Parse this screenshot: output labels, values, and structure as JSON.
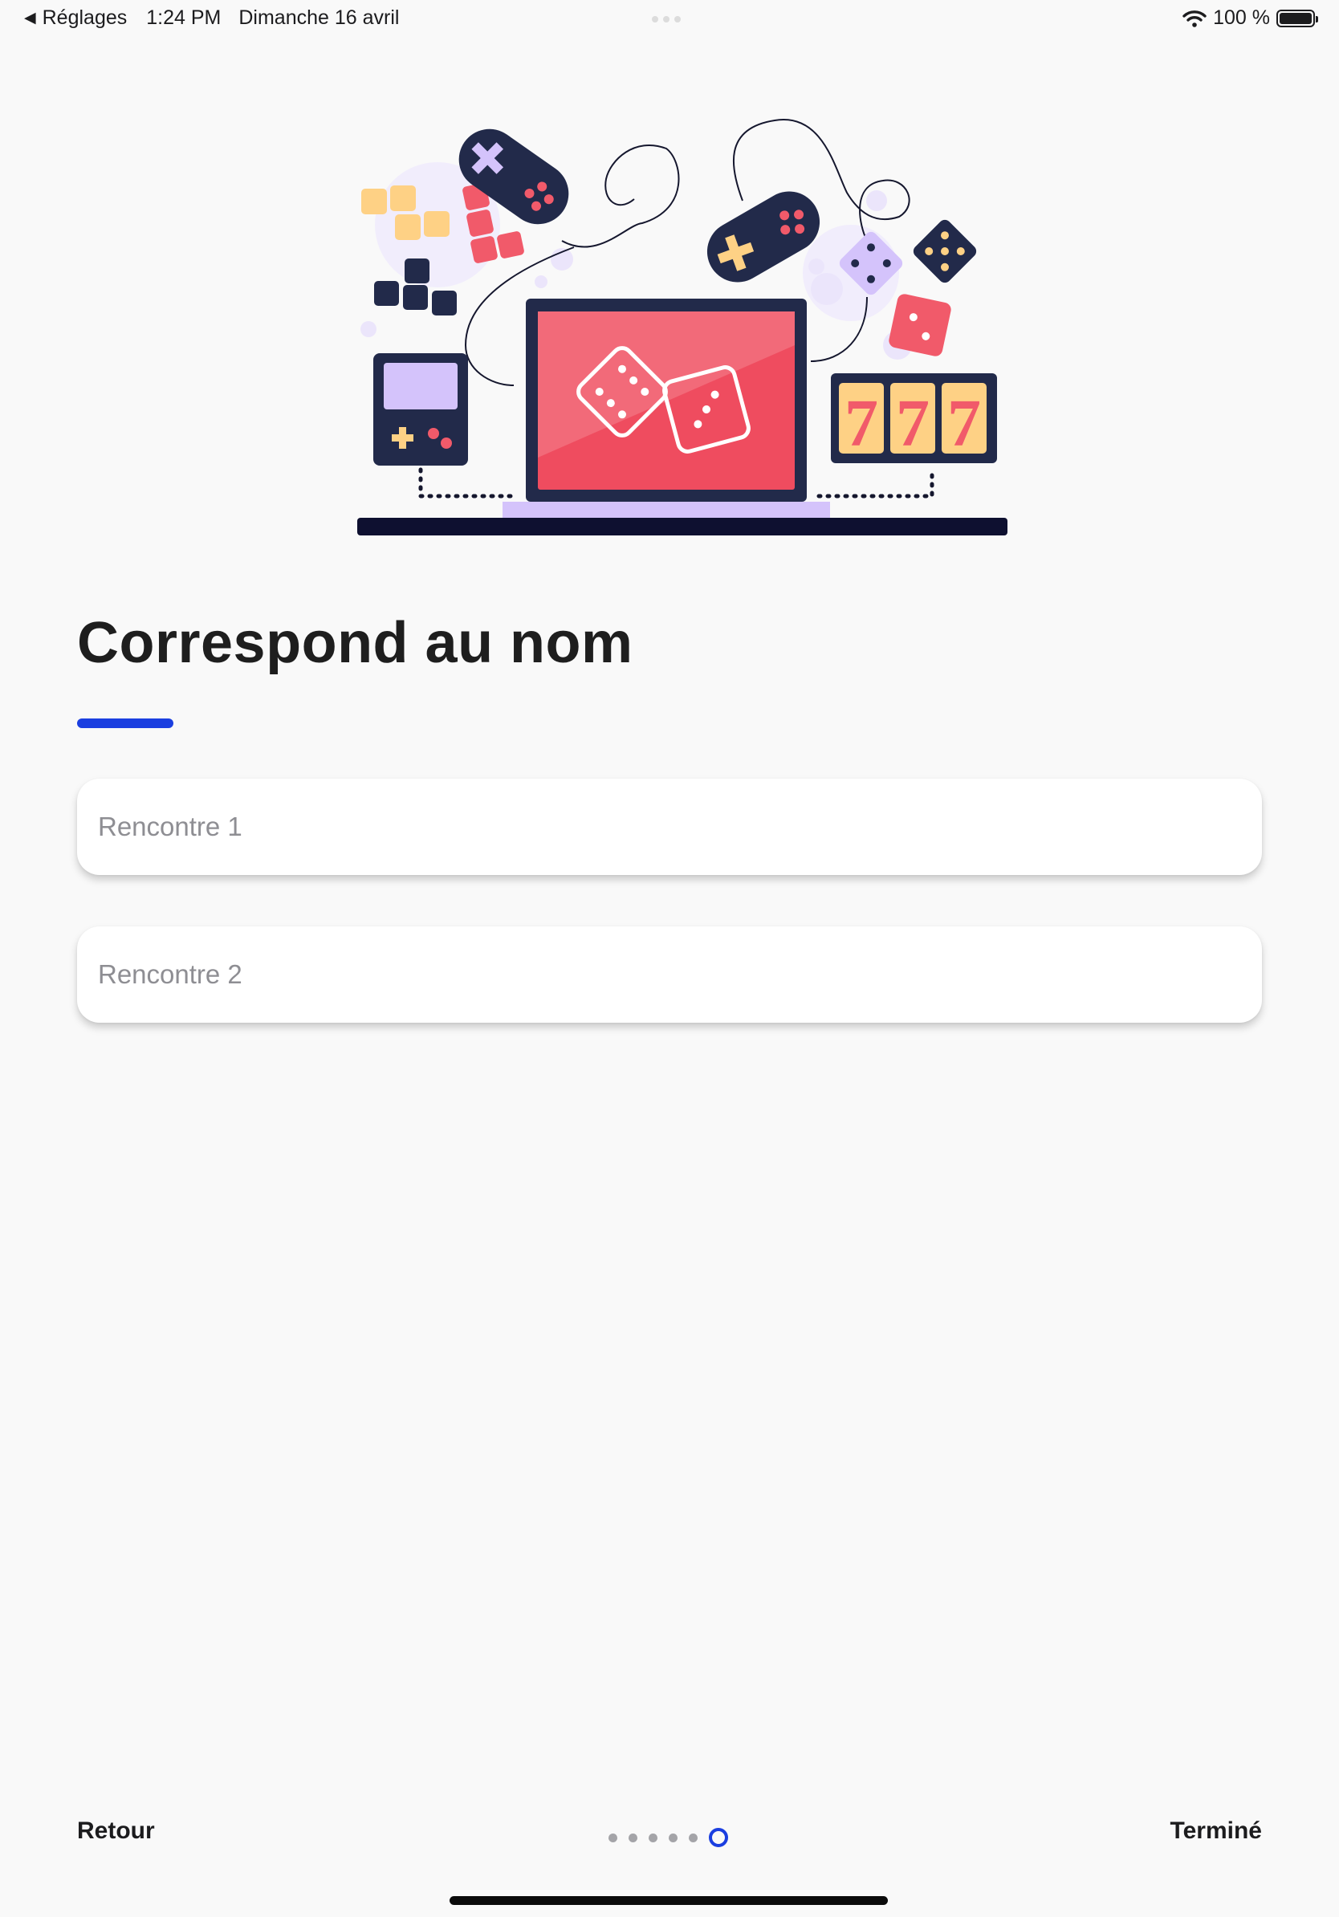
{
  "status_bar": {
    "back_label": "Réglages",
    "time": "1:24 PM",
    "date": "Dimanche 16 avril",
    "battery_text": "100 %",
    "battery_level": 1.0,
    "icons": [
      "back-triangle-icon",
      "wifi-icon",
      "battery-icon"
    ]
  },
  "illustration": {
    "name": "gaming-illustration",
    "slot_digits": [
      "7",
      "7",
      "7"
    ]
  },
  "screen": {
    "title": "Correspond au nom",
    "accent_color": "#1b3fe0"
  },
  "fields": [
    {
      "value": "",
      "placeholder": "Rencontre 1"
    },
    {
      "value": "",
      "placeholder": "Rencontre 2"
    }
  ],
  "footer": {
    "back_label": "Retour",
    "done_label": "Terminé",
    "pager": {
      "total": 6,
      "current": 6
    }
  }
}
